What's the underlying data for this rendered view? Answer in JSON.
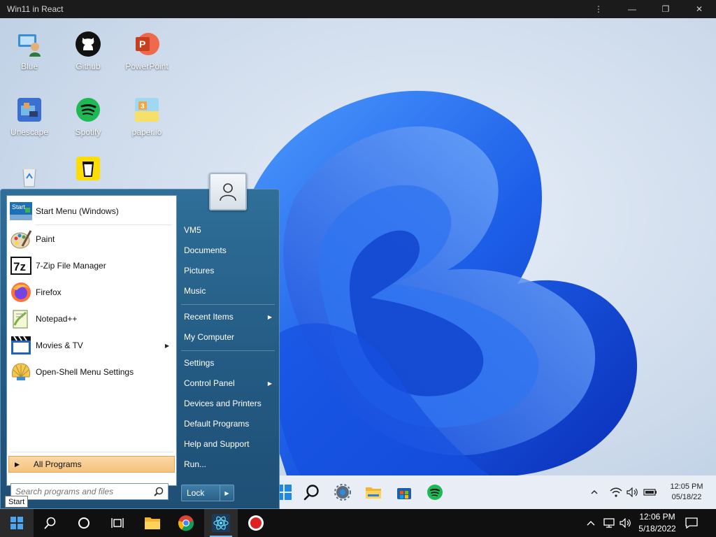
{
  "window": {
    "title": "Win11 in React",
    "controls": [
      "⋮",
      "—",
      "❐",
      "✕"
    ]
  },
  "desktop": {
    "icons": [
      {
        "label": "Blue",
        "icon": "blue-person-icon"
      },
      {
        "label": "Github",
        "icon": "github-icon"
      },
      {
        "label": "PowerPoint",
        "icon": "powerpoint-icon"
      },
      {
        "label": "Unescape",
        "icon": "unescape-game-icon"
      },
      {
        "label": "Spotify",
        "icon": "spotify-icon"
      },
      {
        "label": "paper.io",
        "icon": "paperio-icon"
      },
      {
        "label": "",
        "icon": "recycle-bin-icon"
      },
      {
        "label": "",
        "icon": "buy-me-a-coffee-icon"
      }
    ]
  },
  "win11_taskbar": {
    "icons": [
      "windows-icon",
      "search-icon",
      "settings-icon",
      "file-explorer-icon",
      "store-icon",
      "spotify-icon"
    ],
    "tray_icons": [
      "chevron-up-icon",
      "wifi-icon",
      "volume-icon",
      "battery-icon"
    ],
    "time": "12:05 PM",
    "date": "05/18/22"
  },
  "start_menu": {
    "programs": [
      {
        "label": "Start Menu (Windows)",
        "icon": "start-menu-icon"
      },
      {
        "label": "Paint",
        "icon": "paint-icon"
      },
      {
        "label": "7-Zip File Manager",
        "icon": "7zip-icon"
      },
      {
        "label": "Firefox",
        "icon": "firefox-icon"
      },
      {
        "label": "Notepad++",
        "icon": "notepadpp-icon"
      },
      {
        "label": "Movies & TV",
        "icon": "movies-icon",
        "submenu": true
      },
      {
        "label": "Open-Shell Menu Settings",
        "icon": "openshell-icon"
      }
    ],
    "start_icon_text": "Start",
    "all_programs": "All Programs",
    "search_placeholder": "Search programs and files",
    "right_items": [
      {
        "label": "VM5"
      },
      {
        "label": "Documents"
      },
      {
        "label": "Pictures"
      },
      {
        "label": "Music"
      },
      {
        "label": "Recent Items",
        "submenu": true
      },
      {
        "label": "My Computer"
      },
      {
        "label": "Settings"
      },
      {
        "label": "Control Panel",
        "submenu": true
      },
      {
        "label": "Devices and Printers"
      },
      {
        "label": "Default Programs"
      },
      {
        "label": "Help and Support"
      },
      {
        "label": "Run..."
      }
    ],
    "lock_label": "Lock",
    "tooltip": "Start"
  },
  "taskbar": {
    "icons": [
      "windows-start-icon",
      "search-icon",
      "cortana-icon",
      "task-view-icon",
      "file-explorer-icon",
      "chrome-icon",
      "react-app-icon",
      "record-icon"
    ],
    "tray_icons": [
      "chevron-up-icon",
      "network-icon",
      "volume-icon"
    ],
    "time": "12:06 PM",
    "date": "5/18/2022",
    "notification_icon": "notification-icon"
  },
  "colors": {
    "accent": "#76b9ed",
    "start_menu": "#2a6189",
    "all_programs_highlight": "#f4c27d",
    "taskbar": "#101010"
  }
}
